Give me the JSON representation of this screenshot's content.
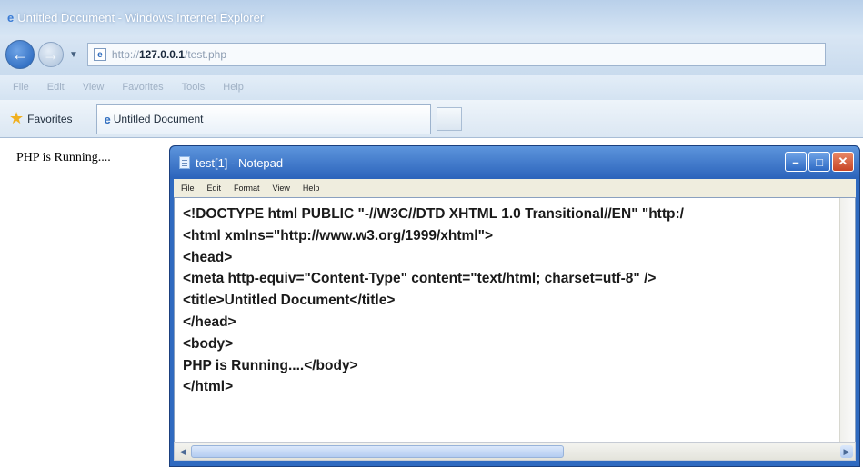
{
  "ie": {
    "title": "Untitled Document - Windows Internet Explorer",
    "address": {
      "protocol": "http://",
      "host": "127.0.0.1",
      "path": "/test.php"
    },
    "menu": [
      "File",
      "Edit",
      "View",
      "Favorites",
      "Tools",
      "Help"
    ],
    "favorites_label": "Favorites",
    "tab_title": "Untitled Document"
  },
  "page": {
    "body_text": "PHP is Running...."
  },
  "notepad": {
    "title": "test[1] - Notepad",
    "menu": [
      "File",
      "Edit",
      "Format",
      "View",
      "Help"
    ],
    "source_lines": [
      "<!DOCTYPE html PUBLIC \"-//W3C//DTD XHTML 1.0 Transitional//EN\" \"http:/",
      "<html xmlns=\"http://www.w3.org/1999/xhtml\">",
      "<head>",
      "<meta http-equiv=\"Content-Type\" content=\"text/html; charset=utf-8\" />",
      "<title>Untitled Document</title>",
      "</head>",
      "<body>",
      "PHP is Running....</body>",
      "</html>"
    ]
  },
  "icons": {
    "back": "back-arrow-icon",
    "forward": "forward-arrow-icon",
    "favorites": "star-icon",
    "page": "ie-page-icon",
    "notepad": "notepad-icon"
  }
}
